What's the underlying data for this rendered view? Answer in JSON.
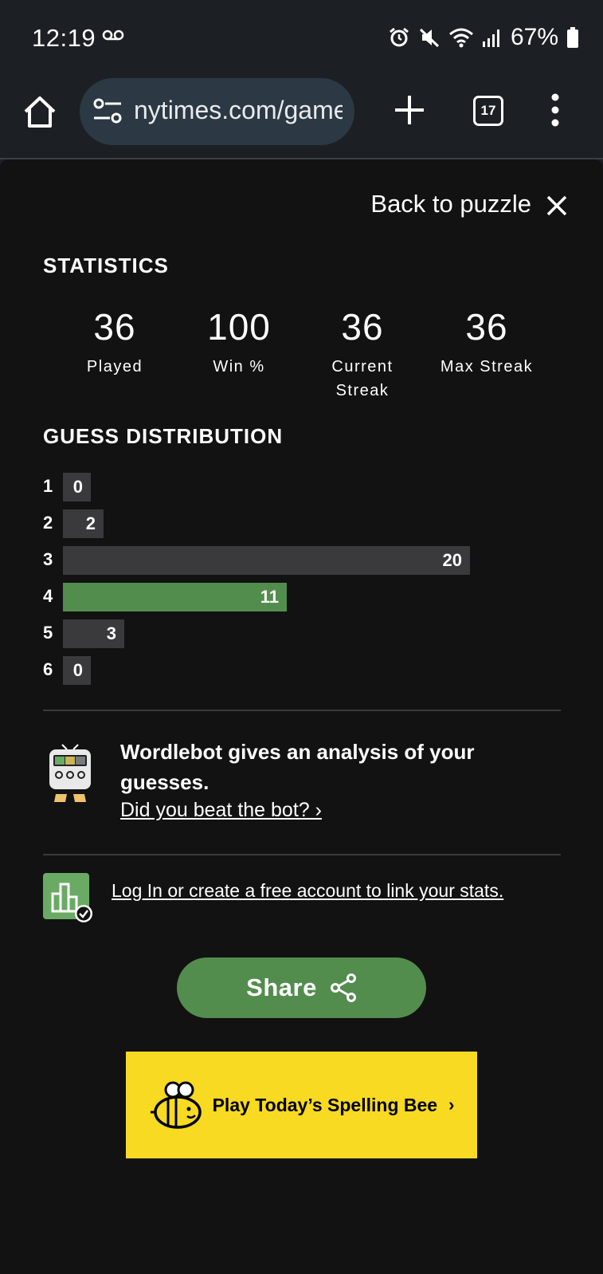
{
  "status_bar": {
    "time": "12:19",
    "battery": "67%",
    "icons": [
      "voicemail-icon",
      "alarm-icon",
      "mute-icon",
      "wifi-icon",
      "signal-icon",
      "battery-icon"
    ]
  },
  "browser": {
    "url": "nytimes.com/games/wordle",
    "tab_count": "17"
  },
  "modal": {
    "back_label": "Back to puzzle",
    "statistics_heading": "STATISTICS",
    "stats": [
      {
        "value": "36",
        "label": "Played"
      },
      {
        "value": "100",
        "label": "Win %"
      },
      {
        "value": "36",
        "label": "Current Streak"
      },
      {
        "value": "36",
        "label": "Max Streak"
      }
    ],
    "distribution_heading": "GUESS DISTRIBUTION",
    "distribution": [
      {
        "guess": "1",
        "count": 0,
        "label": "0",
        "highlight": false
      },
      {
        "guess": "2",
        "count": 2,
        "label": "2",
        "highlight": false
      },
      {
        "guess": "3",
        "count": 20,
        "label": "20",
        "highlight": false
      },
      {
        "guess": "4",
        "count": 11,
        "label": "11",
        "highlight": true
      },
      {
        "guess": "5",
        "count": 3,
        "label": "3",
        "highlight": false
      },
      {
        "guess": "6",
        "count": 0,
        "label": "0",
        "highlight": false
      }
    ],
    "wordlebot_text": "Wordlebot gives an analysis of your guesses.",
    "wordlebot_link": "Did you beat the bot? ›",
    "login_link": "Log In or create a free account to link your stats.",
    "share_label": "Share",
    "spelling_bee_label": "Play Today’s Spelling Bee",
    "spelling_bee_chevron": "›"
  },
  "colors": {
    "win_green": "#538d4e",
    "bar_gray": "#3a3a3c",
    "bee_yellow": "#f7da21",
    "panel_bg": "#121213"
  }
}
